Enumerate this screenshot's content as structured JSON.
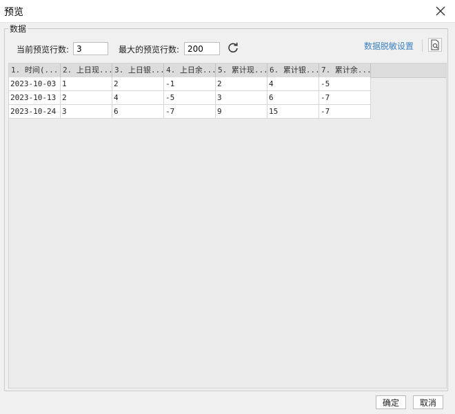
{
  "window": {
    "title": "预览"
  },
  "section": {
    "legend": "数据"
  },
  "controls": {
    "current_rows_label": "当前预览行数:",
    "current_rows_value": "3",
    "max_rows_label": "最大的预览行数:",
    "max_rows_value": "200",
    "mask_settings_link": "数据脱敏设置"
  },
  "table": {
    "columns": [
      "1. 时间(...",
      "2. 上日现...",
      "3. 上日银...",
      "4. 上日余...",
      "5. 累计现...",
      "6. 累计银...",
      "7. 累计余..."
    ],
    "rows": [
      [
        "2023-10-03",
        "1",
        "2",
        "-1",
        "2",
        "4",
        "-5"
      ],
      [
        "2023-10-13",
        "2",
        "4",
        "-5",
        "3",
        "6",
        "-7"
      ],
      [
        "2023-10-24",
        "3",
        "6",
        "-7",
        "9",
        "15",
        "-7"
      ]
    ]
  },
  "footer": {
    "ok_label": "确定",
    "cancel_label": "取消"
  },
  "icons": {
    "close": "close-icon",
    "refresh": "refresh-icon",
    "preview": "preview-search-icon"
  },
  "colors": {
    "link": "#3d82c4",
    "header_bg": "#dcdcdc",
    "window_bg": "#f0f0f0"
  }
}
